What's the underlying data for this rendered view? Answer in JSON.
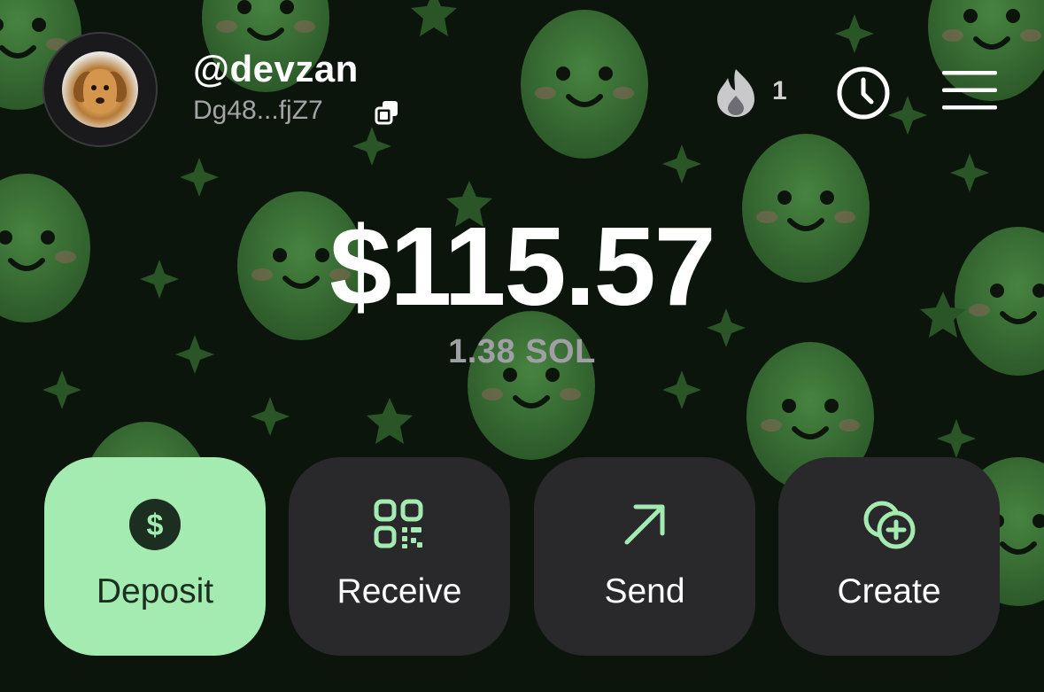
{
  "profile": {
    "handle": "@devzan",
    "address": "Dg48...fjZ7",
    "icon_copy": "copy-icon",
    "avatar": "dog-photo"
  },
  "header": {
    "streak_count": "1",
    "icons": [
      "flame-icon",
      "clock-icon",
      "hamburger-menu-icon"
    ]
  },
  "wallet": {
    "balance_usd": "$115.57",
    "balance_sol": "1.38 SOL"
  },
  "actions": [
    {
      "label": "Deposit",
      "icon": "dollar-circle-icon",
      "color": "#a3ebb1"
    },
    {
      "label": "Receive",
      "icon": "qr-code-icon",
      "color": "#29292c"
    },
    {
      "label": "Send",
      "icon": "arrow-up-right-icon",
      "color": "#29292c"
    },
    {
      "label": "Create",
      "icon": "add-circle-icon",
      "color": "#29292c"
    }
  ],
  "colors": {
    "accent": "#a3ebb1",
    "background": "#0b150c",
    "button": "#29292c",
    "pattern": "#3f7a3a"
  }
}
